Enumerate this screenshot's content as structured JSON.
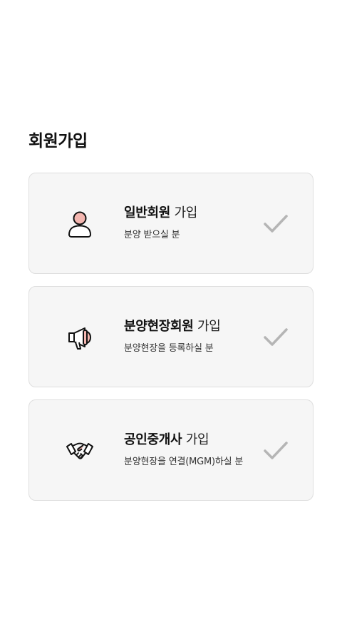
{
  "page": {
    "title": "회원가입"
  },
  "colors": {
    "card_background": "#f6f6f6",
    "card_border": "#dedede",
    "icon_accent": "#f4b6b0",
    "check_gray": "#b5b5b5"
  },
  "options": [
    {
      "title_strong": "일반회원",
      "title_light": " 가입",
      "description": "분양 받으실 분",
      "icon": "person-icon"
    },
    {
      "title_strong": "분양현장회원",
      "title_light": " 가입",
      "description": "분양현장을 등록하실 분",
      "icon": "megaphone-icon"
    },
    {
      "title_strong": "공인중개사",
      "title_light": " 가입",
      "description": "분양현장을 연결(MGM)하실 분",
      "icon": "handshake-icon"
    }
  ]
}
